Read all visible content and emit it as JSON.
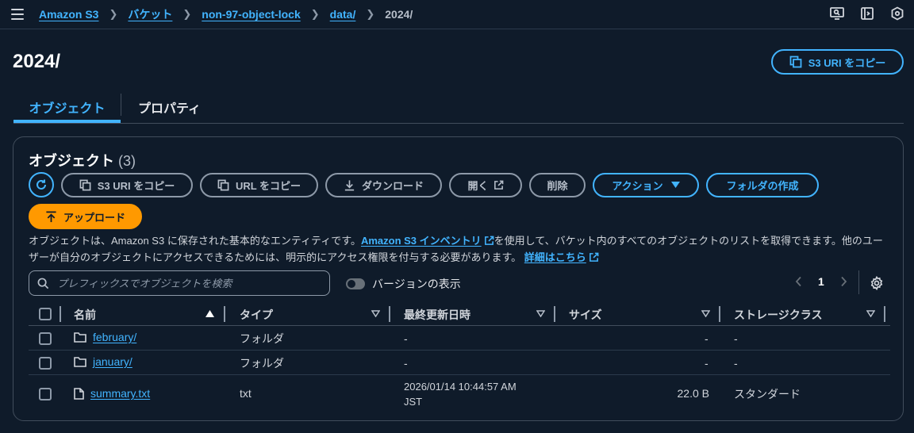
{
  "breadcrumb": {
    "items": [
      "Amazon S3",
      "バケット",
      "non-97-object-lock",
      "data/"
    ],
    "current": "2024/"
  },
  "header": {
    "title": "2024/",
    "copy_uri_label": "S3 URI をコピー"
  },
  "tabs": [
    {
      "label": "オブジェクト",
      "active": true
    },
    {
      "label": "プロパティ",
      "active": false
    }
  ],
  "objects_panel": {
    "title": "オブジェクト",
    "count": "(3)",
    "toolbar": {
      "copy_s3_uri": "S3 URI をコピー",
      "copy_url": "URL をコピー",
      "download": "ダウンロード",
      "open": "開く",
      "delete": "削除",
      "actions": "アクション",
      "create_folder": "フォルダの作成",
      "upload": "アップロード"
    },
    "description": {
      "part1": "オブジェクトは、Amazon S3 に保存された基本的なエンティティです。",
      "inventory_link": "Amazon S3 インベントリ",
      "part2": "を使用して、バケット内のすべてのオブジェクトのリストを取得できます。他のユーザーが自分のオブジェクトにアクセスできるためには、明示的にアクセス権限を付与する必要があります。",
      "learn_more_link": "詳細はこちら"
    },
    "search": {
      "placeholder": "プレフィックスでオブジェクトを検索",
      "value": ""
    },
    "show_versions_label": "バージョンの表示",
    "pagination": {
      "current_page": "1"
    },
    "table": {
      "columns": [
        "名前",
        "タイプ",
        "最終更新日時",
        "サイズ",
        "ストレージクラス"
      ],
      "rows": [
        {
          "name": "february/",
          "type": "フォルダ",
          "modified": "-",
          "size": "-",
          "storage_class": "-",
          "icon": "folder-icon"
        },
        {
          "name": "january/",
          "type": "フォルダ",
          "modified": "-",
          "size": "-",
          "storage_class": "-",
          "icon": "folder-icon"
        },
        {
          "name": "summary.txt",
          "type": "txt",
          "modified_line1": "2026/01/14 10:44:57 AM",
          "modified_line2": "JST",
          "size": "22.0 B",
          "storage_class": "スタンダード",
          "icon": "file-icon"
        }
      ]
    }
  },
  "colors": {
    "background": "#0f1b2a",
    "link": "#42b4ff",
    "accent_orange": "#ff9900",
    "border": "#414d5c"
  }
}
